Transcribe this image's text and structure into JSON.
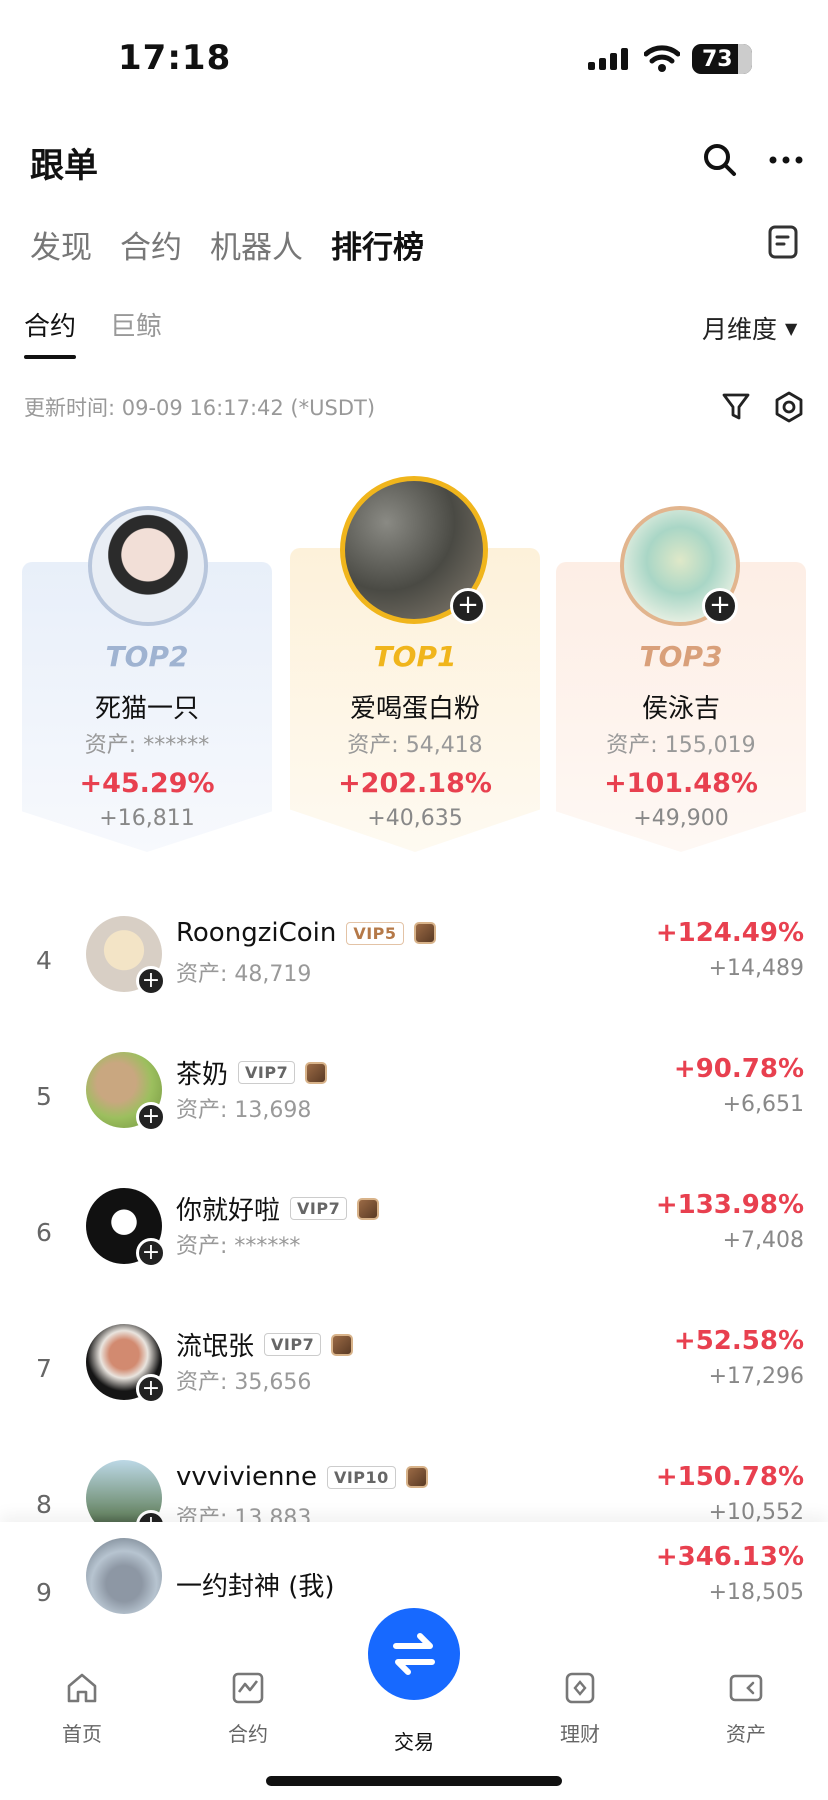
{
  "status_bar": {
    "time": "17:18",
    "battery": "73"
  },
  "header": {
    "title": "跟单"
  },
  "tabs": [
    "发现",
    "合约",
    "机器人",
    "排行榜"
  ],
  "subtabs": [
    "合约",
    "巨鲸"
  ],
  "period": "月维度",
  "update_time": "更新时间: 09-09 16:17:42 (*USDT)",
  "podium": [
    {
      "rank": "TOP2",
      "name": "死猫一只",
      "asset": "资产: ******",
      "pct": "+45.29%",
      "amount": "+16,811"
    },
    {
      "rank": "TOP1",
      "name": "爱喝蛋白粉",
      "asset": "资产: 54,418",
      "pct": "+202.18%",
      "amount": "+40,635"
    },
    {
      "rank": "TOP3",
      "name": "侯泳吉",
      "asset": "资产: 155,019",
      "pct": "+101.48%",
      "amount": "+49,900"
    }
  ],
  "list": [
    {
      "num": "4",
      "name": "RoongziCoin",
      "vip": "VIP5",
      "asset": "资产: 48,719",
      "pct": "+124.49%",
      "amount": "+14,489"
    },
    {
      "num": "5",
      "name": "茶奶",
      "vip": "VIP7",
      "asset": "资产: 13,698",
      "pct": "+90.78%",
      "amount": "+6,651"
    },
    {
      "num": "6",
      "name": "你就好啦",
      "vip": "VIP7",
      "asset": "资产: ******",
      "pct": "+133.98%",
      "amount": "+7,408"
    },
    {
      "num": "7",
      "name": "流氓张",
      "vip": "VIP7",
      "asset": "资产: 35,656",
      "pct": "+52.58%",
      "amount": "+17,296"
    },
    {
      "num": "8",
      "name": "vvvivienne",
      "vip": "VIP10",
      "asset": "资产: 13,883",
      "pct": "+150.78%",
      "amount": "+10,552"
    }
  ],
  "me": {
    "num": "9",
    "name": "一约封神 (我)",
    "pct": "+346.13%",
    "amount": "+18,505"
  },
  "nav": [
    "首页",
    "合约",
    "交易",
    "理财",
    "资产"
  ],
  "colors": {
    "positive": "#e8404f",
    "accent": "#1769ff",
    "top1": "#f0b51c",
    "top2": "#9fb3d1",
    "top3": "#d9a07a"
  }
}
